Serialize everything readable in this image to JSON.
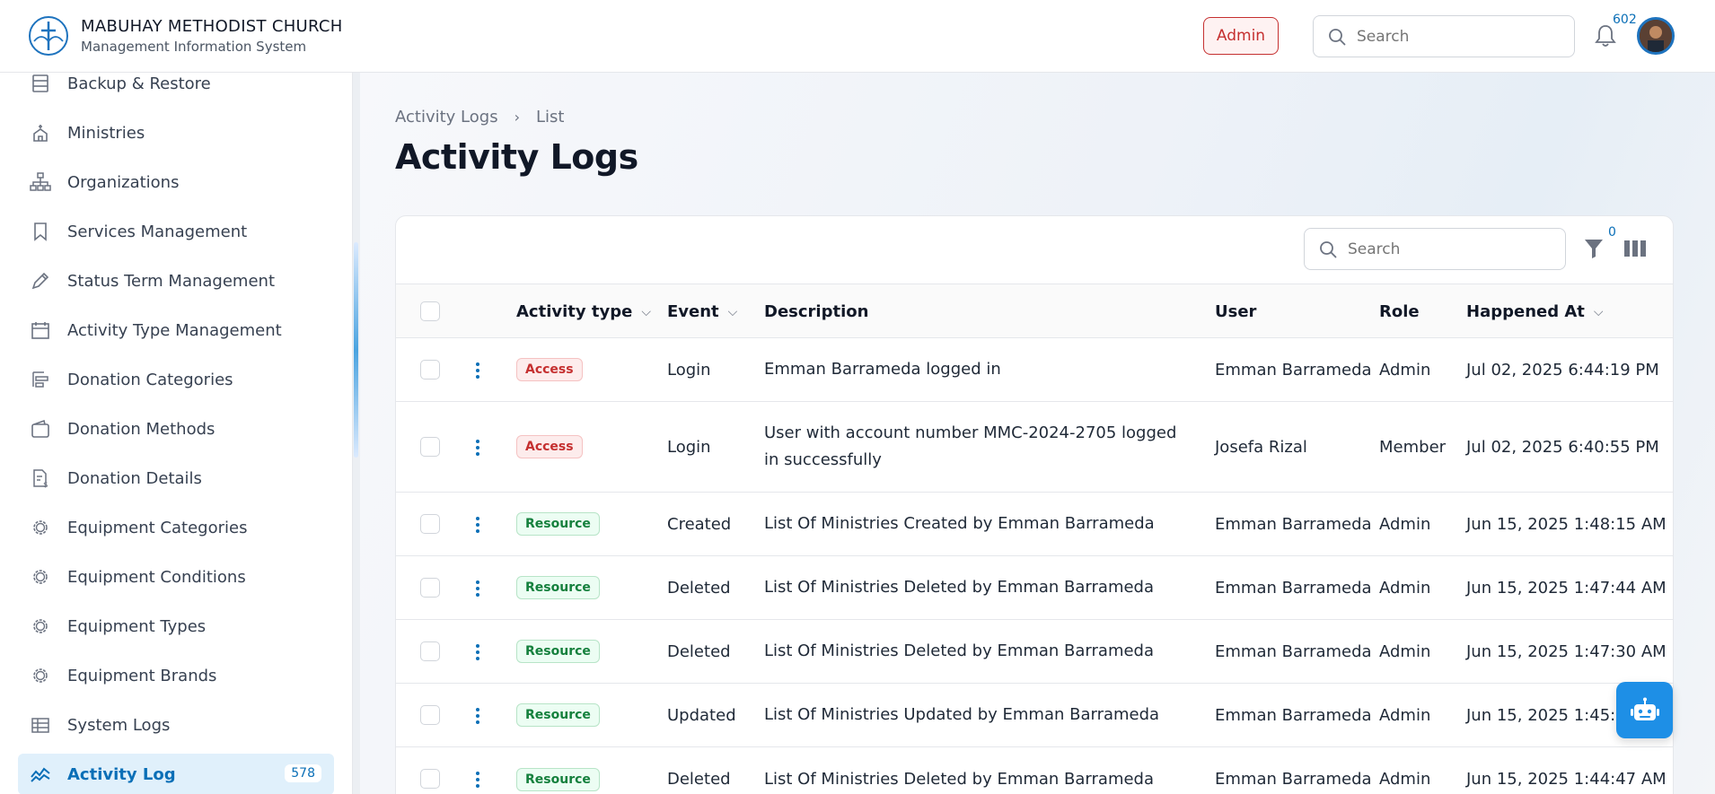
{
  "app": {
    "title": "MABUHAY METHODIST CHURCH",
    "subtitle": "Management Information System",
    "role_badge": "Admin",
    "search_placeholder": "Search",
    "notification_count": "602"
  },
  "sidebar": {
    "items": [
      {
        "label": "Backup & Restore",
        "icon": "database-icon"
      },
      {
        "label": "Ministries",
        "icon": "church-icon"
      },
      {
        "label": "Organizations",
        "icon": "org-chart-icon"
      },
      {
        "label": "Services Management",
        "icon": "bookmark-icon"
      },
      {
        "label": "Status Term Management",
        "icon": "pen-icon"
      },
      {
        "label": "Activity Type Management",
        "icon": "calendar-icon"
      },
      {
        "label": "Donation Categories",
        "icon": "align-icon"
      },
      {
        "label": "Donation Methods",
        "icon": "wallet-icon"
      },
      {
        "label": "Donation Details",
        "icon": "document-dollar-icon"
      },
      {
        "label": "Equipment Categories",
        "icon": "cog-icon"
      },
      {
        "label": "Equipment Conditions",
        "icon": "cog-icon"
      },
      {
        "label": "Equipment Types",
        "icon": "cog-icon"
      },
      {
        "label": "Equipment Brands",
        "icon": "cog-icon"
      },
      {
        "label": "System Logs",
        "icon": "table-icon"
      },
      {
        "label": "Activity Log",
        "icon": "activity-icon",
        "count": "578",
        "active": true
      }
    ]
  },
  "page": {
    "breadcrumb": [
      "Activity Logs",
      "List"
    ],
    "title": "Activity Logs"
  },
  "table": {
    "search_placeholder": "Search",
    "filter_count": "0",
    "columns": [
      "Activity type",
      "Event",
      "Description",
      "User",
      "Role",
      "Happened At"
    ],
    "rows": [
      {
        "type": "Access",
        "event": "Login",
        "description": "Emman Barrameda logged in",
        "user": "Emman Barrameda",
        "role": "Admin",
        "happened_at": "Jul 02, 2025 6:44:19 PM"
      },
      {
        "type": "Access",
        "event": "Login",
        "description": "User with account number MMC-2024-2705 logged in successfully",
        "user": "Josefa Rizal",
        "role": "Member",
        "happened_at": "Jul 02, 2025 6:40:55 PM"
      },
      {
        "type": "Resource",
        "event": "Created",
        "description": "List Of Ministries Created by Emman Barrameda",
        "user": "Emman Barrameda",
        "role": "Admin",
        "happened_at": "Jun 15, 2025 1:48:15 AM"
      },
      {
        "type": "Resource",
        "event": "Deleted",
        "description": "List Of Ministries Deleted by Emman Barrameda",
        "user": "Emman Barrameda",
        "role": "Admin",
        "happened_at": "Jun 15, 2025 1:47:44 AM"
      },
      {
        "type": "Resource",
        "event": "Deleted",
        "description": "List Of Ministries Deleted by Emman Barrameda",
        "user": "Emman Barrameda",
        "role": "Admin",
        "happened_at": "Jun 15, 2025 1:47:30 AM"
      },
      {
        "type": "Resource",
        "event": "Updated",
        "description": "List Of Ministries Updated by Emman Barrameda",
        "user": "Emman Barrameda",
        "role": "Admin",
        "happened_at": "Jun 15, 2025 1:45:17 AM"
      },
      {
        "type": "Resource",
        "event": "Deleted",
        "description": "List Of Ministries Deleted by Emman Barrameda",
        "user": "Emman Barrameda",
        "role": "Admin",
        "happened_at": "Jun 15, 2025 1:44:47 AM"
      }
    ]
  },
  "colors": {
    "accent": "#0a6fb7",
    "access_badge": "#c53030",
    "resource_badge": "#15803d"
  }
}
